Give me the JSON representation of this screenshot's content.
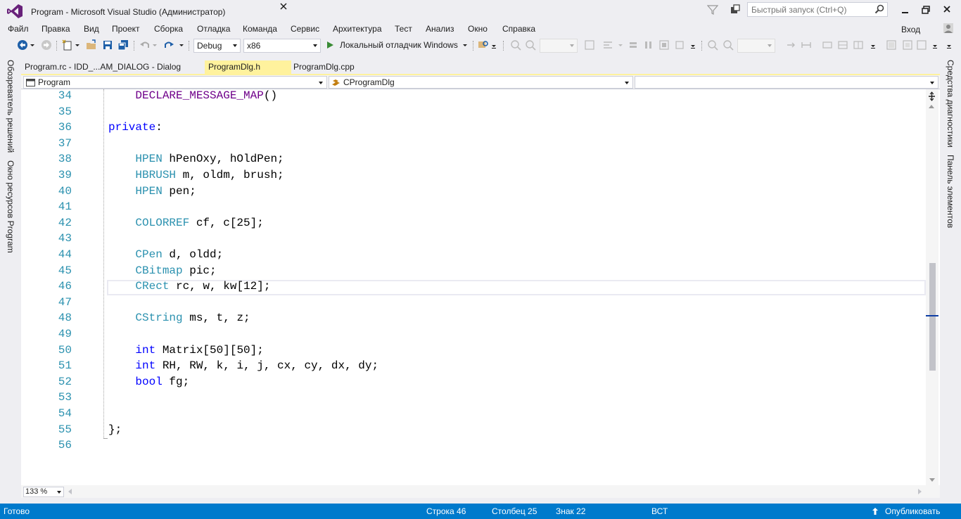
{
  "window": {
    "title": "Program - Microsoft Visual Studio (Администратор)",
    "quick_launch_placeholder": "Быстрый запуск (Ctrl+Q)",
    "login_label": "Вход"
  },
  "menu": [
    "Файл",
    "Правка",
    "Вид",
    "Проект",
    "Сборка",
    "Отладка",
    "Команда",
    "Сервис",
    "Архитектура",
    "Тест",
    "Анализ",
    "Окно",
    "Справка"
  ],
  "toolbar": {
    "configuration": "Debug",
    "platform": "x86",
    "debugger_label": "Локальный отладчик Windows"
  },
  "left_sidebar": {
    "solution_explorer": "Обозреватель решений",
    "resource_view": "Окно ресурсов Program"
  },
  "right_sidebar": {
    "diagnostics": "Средства диагностики",
    "toolbox": "Панель элементов"
  },
  "tabs": [
    {
      "label": "Program.rc - IDD_...AM_DIALOG - Dialog",
      "active": false
    },
    {
      "label": "ProgramDlg.h",
      "active": true
    },
    {
      "label": "ProgramDlg.cpp",
      "active": false
    }
  ],
  "navbar": {
    "project": "Program",
    "scope": "CProgramDlg",
    "member": ""
  },
  "editor": {
    "current_line": 46,
    "lines": [
      {
        "n": "34",
        "code": [
          {
            "t": "    "
          },
          {
            "t": "DECLARE_MESSAGE_MAP",
            "c": "mac"
          },
          {
            "t": "()"
          }
        ]
      },
      {
        "n": "35",
        "code": []
      },
      {
        "n": "36",
        "code": [
          {
            "t": "private",
            "c": "kw"
          },
          {
            "t": ":"
          }
        ]
      },
      {
        "n": "37",
        "code": []
      },
      {
        "n": "38",
        "code": [
          {
            "t": "    "
          },
          {
            "t": "HPEN",
            "c": "ty"
          },
          {
            "t": " hPenOxy, hOldPen;"
          }
        ]
      },
      {
        "n": "39",
        "code": [
          {
            "t": "    "
          },
          {
            "t": "HBRUSH",
            "c": "ty"
          },
          {
            "t": " m, oldm, brush;"
          }
        ]
      },
      {
        "n": "40",
        "code": [
          {
            "t": "    "
          },
          {
            "t": "HPEN",
            "c": "ty"
          },
          {
            "t": " pen;"
          }
        ]
      },
      {
        "n": "41",
        "code": []
      },
      {
        "n": "42",
        "code": [
          {
            "t": "    "
          },
          {
            "t": "COLORREF",
            "c": "ty"
          },
          {
            "t": " cf, c[25];"
          }
        ]
      },
      {
        "n": "43",
        "code": []
      },
      {
        "n": "44",
        "code": [
          {
            "t": "    "
          },
          {
            "t": "CPen",
            "c": "ty"
          },
          {
            "t": " d, oldd;"
          }
        ]
      },
      {
        "n": "45",
        "code": [
          {
            "t": "    "
          },
          {
            "t": "CBitmap",
            "c": "ty"
          },
          {
            "t": " pic;"
          }
        ]
      },
      {
        "n": "46",
        "code": [
          {
            "t": "    "
          },
          {
            "t": "CRect",
            "c": "ty"
          },
          {
            "t": " rc, w, kw[12];"
          }
        ]
      },
      {
        "n": "47",
        "code": []
      },
      {
        "n": "48",
        "code": [
          {
            "t": "    "
          },
          {
            "t": "CString",
            "c": "ty"
          },
          {
            "t": " ms, t, z;"
          }
        ]
      },
      {
        "n": "49",
        "code": []
      },
      {
        "n": "50",
        "code": [
          {
            "t": "    "
          },
          {
            "t": "int",
            "c": "kw"
          },
          {
            "t": " Matrix[50][50];"
          }
        ]
      },
      {
        "n": "51",
        "code": [
          {
            "t": "    "
          },
          {
            "t": "int",
            "c": "kw"
          },
          {
            "t": " RH, RW, k, i, j, cx, cy, dx, dy;"
          }
        ]
      },
      {
        "n": "52",
        "code": [
          {
            "t": "    "
          },
          {
            "t": "bool",
            "c": "kw"
          },
          {
            "t": " fg;"
          }
        ]
      },
      {
        "n": "53",
        "code": []
      },
      {
        "n": "54",
        "code": []
      },
      {
        "n": "55",
        "code": [
          {
            "t": "};"
          }
        ]
      },
      {
        "n": "56",
        "code": []
      }
    ],
    "zoom": "133 %"
  },
  "statusbar": {
    "ready": "Готово",
    "line": "Строка 46",
    "column": "Столбец 25",
    "char": "Знак 22",
    "mode": "ВСТ",
    "publish": "Опубликовать"
  },
  "colors": {
    "accent": "#007acc",
    "active_tab": "#fff29d",
    "keyword": "#0000ff",
    "type": "#2b91af",
    "macro": "#6f008a",
    "line_number": "#2b91af"
  }
}
